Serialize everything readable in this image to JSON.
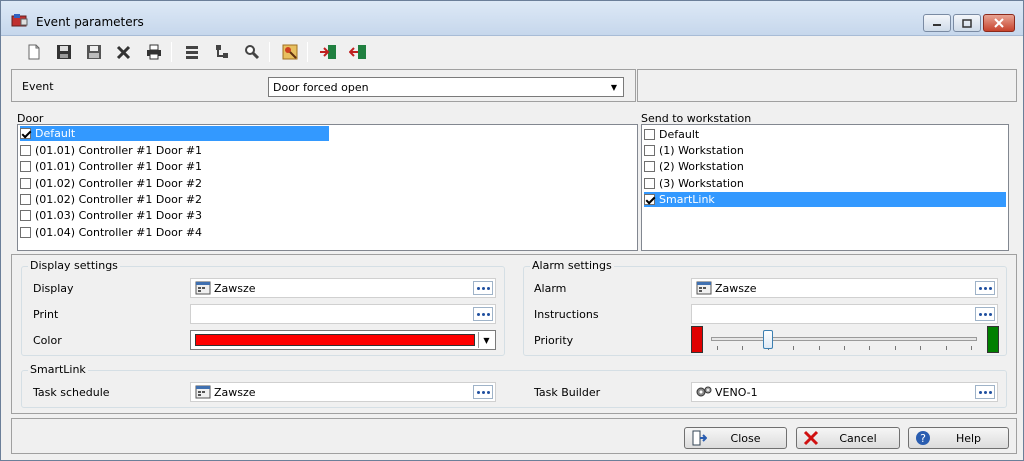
{
  "window": {
    "title": "Event parameters"
  },
  "toolbar": {
    "buttons": [
      "new-icon",
      "save-icon",
      "save-as-icon",
      "delete-icon",
      "print-icon",
      "list-icon",
      "tree-icon",
      "search-icon",
      "wizard-icon",
      "import-icon",
      "export-icon"
    ]
  },
  "event": {
    "label": "Event",
    "selected": "Door forced open"
  },
  "door": {
    "label": "Door",
    "items": [
      {
        "label": "Default",
        "checked": true,
        "selected": true
      },
      {
        "label": "(01.01) Controller #1 Door #1",
        "checked": false,
        "selected": false
      },
      {
        "label": "(01.01) Controller #1 Door #1",
        "checked": false,
        "selected": false
      },
      {
        "label": "(01.02) Controller #1 Door #2",
        "checked": false,
        "selected": false
      },
      {
        "label": "(01.02) Controller #1 Door #2",
        "checked": false,
        "selected": false
      },
      {
        "label": "(01.03) Controller #1 Door #3",
        "checked": false,
        "selected": false
      },
      {
        "label": "(01.04) Controller #1 Door #4",
        "checked": false,
        "selected": false
      }
    ]
  },
  "workstation": {
    "label": "Send to workstation",
    "items": [
      {
        "label": "Default",
        "checked": false,
        "selected": false
      },
      {
        "label": "(1) Workstation",
        "checked": false,
        "selected": false
      },
      {
        "label": "(2) Workstation",
        "checked": false,
        "selected": false
      },
      {
        "label": "(3) Workstation",
        "checked": false,
        "selected": false
      },
      {
        "label": "SmartLink",
        "checked": true,
        "selected": true
      }
    ]
  },
  "display_settings": {
    "title": "Display settings",
    "display_label": "Display",
    "display_value": "Zawsze",
    "print_label": "Print",
    "print_value": "",
    "color_label": "Color",
    "color_value": "#ff0000"
  },
  "alarm_settings": {
    "title": "Alarm settings",
    "alarm_label": "Alarm",
    "alarm_value": "Zawsze",
    "instructions_label": "Instructions",
    "instructions_value": "",
    "priority_label": "Priority",
    "priority_level": 0.2,
    "low_color": "#e00000",
    "high_color": "#008000"
  },
  "smartlink": {
    "title": "SmartLink",
    "task_schedule_label": "Task schedule",
    "task_schedule_value": "Zawsze",
    "task_builder_label": "Task Builder",
    "task_builder_value": "VENO-1"
  },
  "buttons": {
    "close": "Close",
    "cancel": "Cancel",
    "help": "Help"
  }
}
